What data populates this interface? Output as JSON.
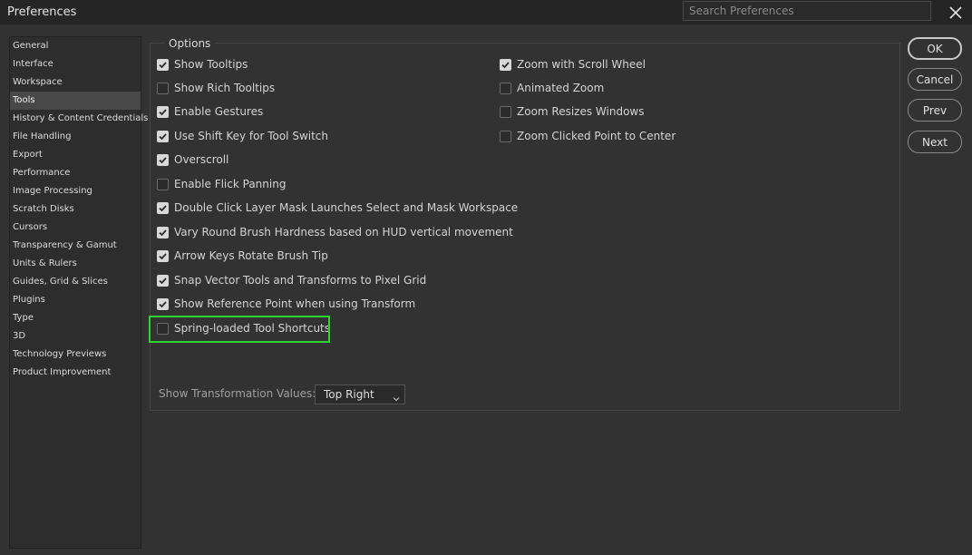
{
  "window": {
    "title": "Preferences"
  },
  "search": {
    "placeholder": "Search Preferences"
  },
  "sidebar": {
    "items": [
      {
        "label": "General",
        "active": false
      },
      {
        "label": "Interface",
        "active": false
      },
      {
        "label": "Workspace",
        "active": false
      },
      {
        "label": "Tools",
        "active": true
      },
      {
        "label": "History & Content Credentials",
        "active": false
      },
      {
        "label": "File Handling",
        "active": false
      },
      {
        "label": "Export",
        "active": false
      },
      {
        "label": "Performance",
        "active": false
      },
      {
        "label": "Image Processing",
        "active": false
      },
      {
        "label": "Scratch Disks",
        "active": false
      },
      {
        "label": "Cursors",
        "active": false
      },
      {
        "label": "Transparency & Gamut",
        "active": false
      },
      {
        "label": "Units & Rulers",
        "active": false
      },
      {
        "label": "Guides, Grid & Slices",
        "active": false
      },
      {
        "label": "Plugins",
        "active": false
      },
      {
        "label": "Type",
        "active": false
      },
      {
        "label": "3D",
        "active": false
      },
      {
        "label": "Technology Previews",
        "active": false
      },
      {
        "label": "Product Improvement",
        "active": false
      }
    ]
  },
  "options": {
    "legend": "Options",
    "left": [
      {
        "label": "Show Tooltips",
        "checked": true
      },
      {
        "label": "Show Rich Tooltips",
        "checked": false
      },
      {
        "label": "Enable Gestures",
        "checked": true
      },
      {
        "label": "Use Shift Key for Tool Switch",
        "checked": true
      },
      {
        "label": "Overscroll",
        "checked": true
      },
      {
        "label": "Enable Flick Panning",
        "checked": false
      },
      {
        "label": "Double Click Layer Mask Launches Select and Mask Workspace",
        "checked": true
      },
      {
        "label": "Vary Round Brush Hardness based on HUD vertical movement",
        "checked": true
      },
      {
        "label": "Arrow Keys Rotate Brush Tip",
        "checked": true
      },
      {
        "label": "Snap Vector Tools and Transforms to Pixel Grid",
        "checked": true
      },
      {
        "label": "Show Reference Point when using Transform",
        "checked": true
      },
      {
        "label": "Spring-loaded Tool Shortcuts",
        "checked": false
      }
    ],
    "right": [
      {
        "label": "Zoom with Scroll Wheel",
        "checked": true
      },
      {
        "label": "Animated Zoom",
        "checked": false
      },
      {
        "label": "Zoom Resizes Windows",
        "checked": false
      },
      {
        "label": "Zoom Clicked Point to Center",
        "checked": false
      }
    ],
    "transformation_values": {
      "label": "Show Transformation Values:",
      "value": "Top Right"
    }
  },
  "buttons": {
    "ok": "OK",
    "cancel": "Cancel",
    "prev": "Prev",
    "next": "Next"
  },
  "colors": {
    "highlight": "#2ed52e",
    "background": "#323232",
    "title_bar": "#252525"
  }
}
